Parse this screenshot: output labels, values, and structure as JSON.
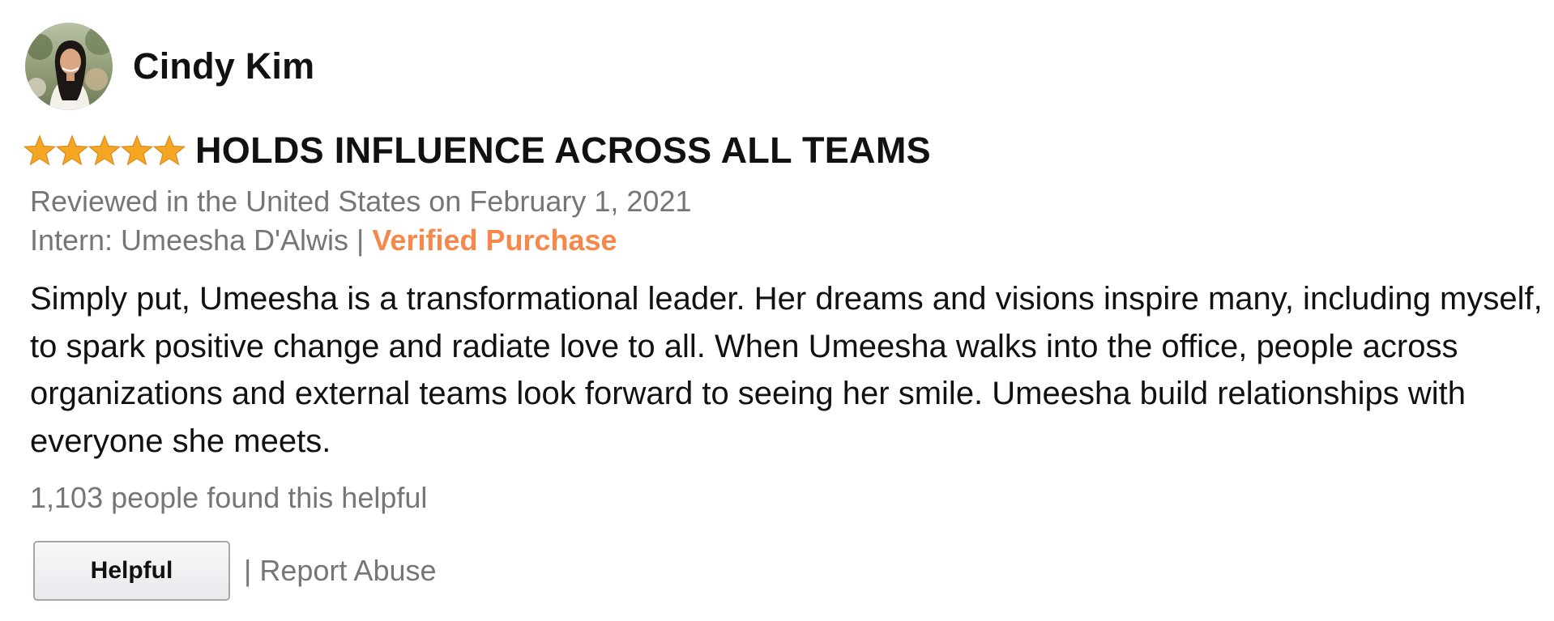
{
  "reviewer": {
    "name": "Cindy Kim",
    "avatar_icon": "profile-photo"
  },
  "rating": {
    "stars": 5,
    "max": 5,
    "star_color": "#f5a623"
  },
  "review": {
    "title": "HOLDS INFLUENCE ACROSS ALL TEAMS",
    "date_line": "Reviewed in the United States on February 1, 2021",
    "variant_label": "Intern: Umeesha D'Alwis",
    "separator": "|",
    "verified_label": "Verified Purchase",
    "body": "Simply put, Umeesha is a transformational leader. Her dreams and visions inspire many, including myself, to spark positive change and radiate love to all. When Umeesha walks into the office, people across organizations and external teams look forward to seeing her smile. Umeesha build relationships with everyone she meets."
  },
  "feedback": {
    "helpful_count": "1,103 people found this helpful",
    "helpful_button_label": "Helpful",
    "separator": "|",
    "report_label": "Report Abuse"
  },
  "colors": {
    "verified": "#f5884a",
    "muted_text": "#767676",
    "primary_text": "#111111"
  }
}
